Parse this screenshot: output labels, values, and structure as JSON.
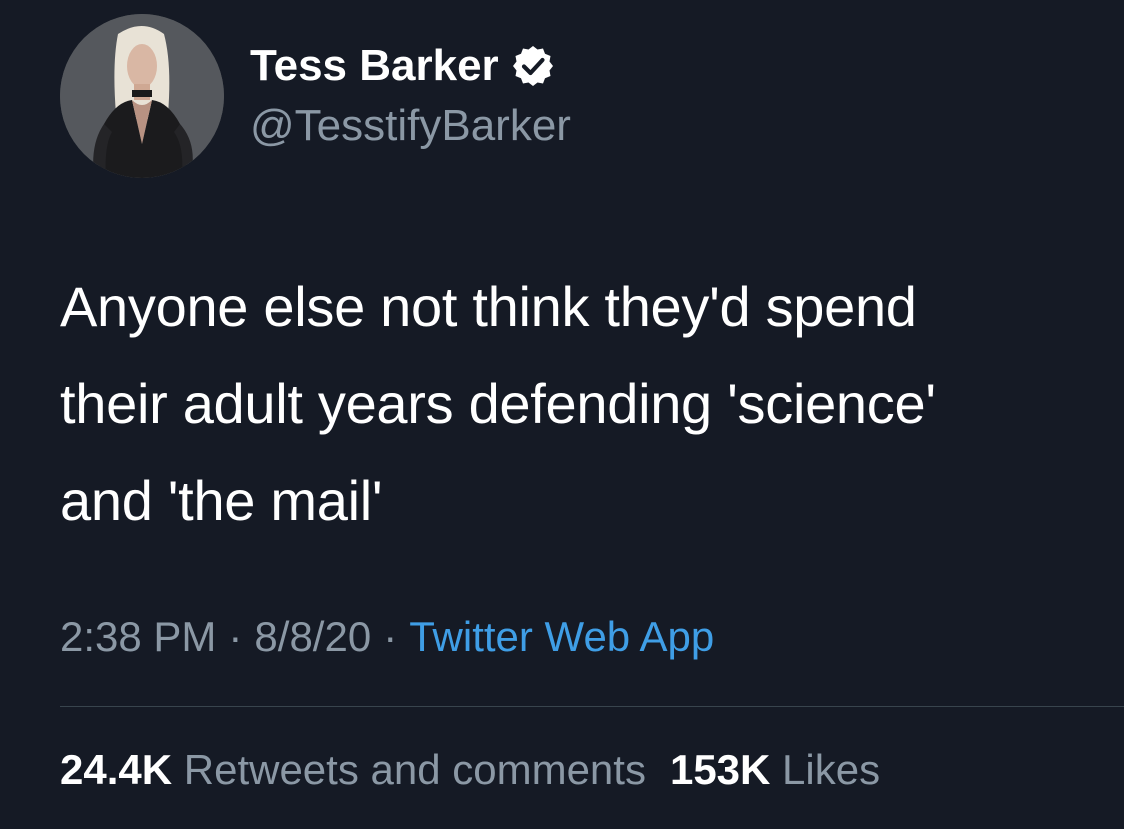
{
  "author": {
    "name": "Tess Barker",
    "handle": "@TesstifyBarker",
    "verified_icon": "verified-badge-icon",
    "avatar_icon": "profile-photo"
  },
  "tweet": {
    "lines": [
      "Anyone else not think they'd spend",
      "their adult years defending 'science'",
      "and 'the mail'"
    ]
  },
  "meta": {
    "time": "2:38 PM",
    "separator": "·",
    "date": "8/8/20",
    "source": "Twitter Web App"
  },
  "stats": {
    "retweets_count": "24.4K",
    "retweets_label": "Retweets and comments",
    "likes_count": "153K",
    "likes_label": "Likes"
  },
  "colors": {
    "background": "#151a25",
    "primary_text": "#ffffff",
    "secondary_text": "#8b98a5",
    "link": "#3f9ee6",
    "divider": "#38444d"
  }
}
